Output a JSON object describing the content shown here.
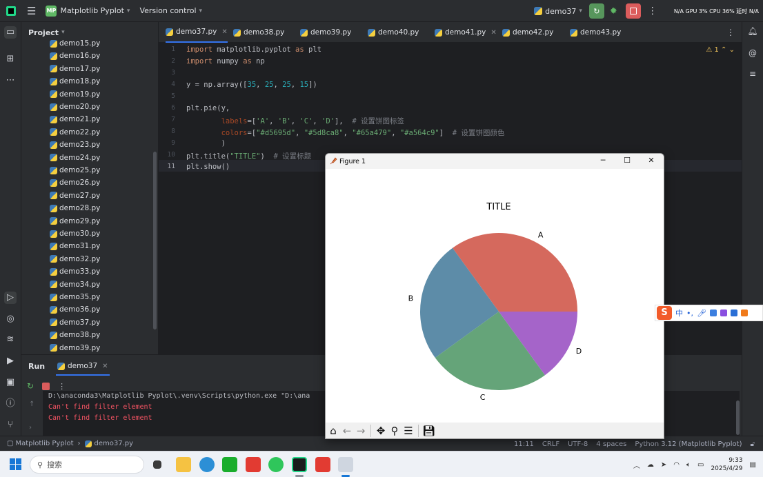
{
  "topbar": {
    "project_badge": "MP",
    "project_name": "Matplotlib Pyplot",
    "vcs_label": "Version control",
    "run_config": "demo37",
    "sys_info": "N/A GPU 3% CPU 36% 延时 N/A"
  },
  "project_panel": {
    "title": "Project",
    "files": [
      "demo15.py",
      "demo16.py",
      "demo17.py",
      "demo18.py",
      "demo19.py",
      "demo20.py",
      "demo21.py",
      "demo22.py",
      "demo23.py",
      "demo24.py",
      "demo25.py",
      "demo26.py",
      "demo27.py",
      "demo28.py",
      "demo29.py",
      "demo30.py",
      "demo31.py",
      "demo32.py",
      "demo33.py",
      "demo34.py",
      "demo35.py",
      "demo36.py",
      "demo37.py",
      "demo38.py",
      "demo39.py"
    ]
  },
  "tabs": [
    {
      "label": "demo37.py",
      "active": true,
      "closable": true
    },
    {
      "label": "demo38.py",
      "active": false,
      "closable": false
    },
    {
      "label": "demo39.py",
      "active": false,
      "closable": false
    },
    {
      "label": "demo40.py",
      "active": false,
      "closable": false
    },
    {
      "label": "demo41.py",
      "active": false,
      "closable": true
    },
    {
      "label": "demo42.py",
      "active": false,
      "closable": false
    },
    {
      "label": "demo43.py",
      "active": false,
      "closable": false
    }
  ],
  "editor": {
    "warning_count": "1",
    "line_numbers": [
      "1",
      "2",
      "3",
      "4",
      "5",
      "6",
      "7",
      "8",
      "9",
      "10",
      "11"
    ],
    "current_line": "11"
  },
  "run_panel": {
    "title": "Run",
    "tab_label": "demo37",
    "command": "D:\\anaconda3\\Matplotlib Pyplot\\.venv\\Scripts\\python.exe \"D:\\ana",
    "errors": [
      "Can't find filter element",
      "Can't find filter element"
    ]
  },
  "statusbar": {
    "crumb_project": "Matplotlib Pyplot",
    "crumb_file": "demo37.py",
    "position": "11:11",
    "line_sep": "CRLF",
    "encoding": "UTF-8",
    "indent": "4 spaces",
    "interpreter": "Python 3.12 (Matplotlib Pyplot)"
  },
  "figure": {
    "window_title": "Figure 1"
  },
  "chart_data": {
    "type": "pie",
    "title": "TITLE",
    "categories": [
      "A",
      "B",
      "C",
      "D"
    ],
    "values": [
      35,
      25,
      25,
      15
    ],
    "colors": [
      "#d5695d",
      "#5d8ca8",
      "#65a479",
      "#a564c9"
    ]
  },
  "ime": {
    "label": "中"
  },
  "taskbar": {
    "search_placeholder": "搜索",
    "time": "9:33",
    "date": "2025/4/29"
  }
}
